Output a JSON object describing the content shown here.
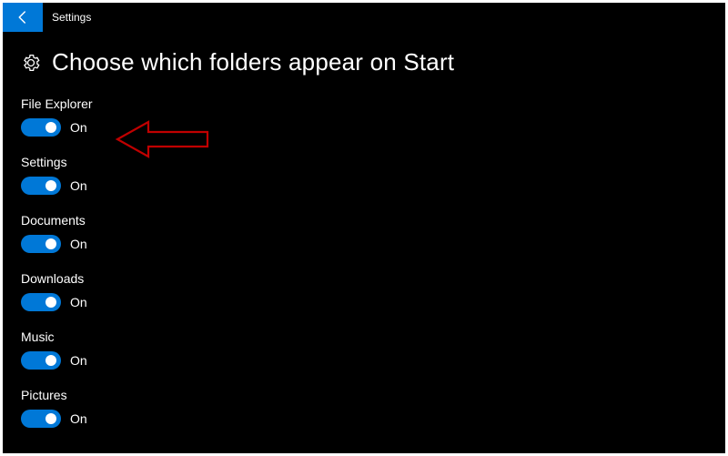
{
  "window": {
    "title": "Settings"
  },
  "page": {
    "title": "Choose which folders appear on Start"
  },
  "toggle_state_on": "On",
  "options": {
    "file_explorer": {
      "label": "File Explorer",
      "state": "On"
    },
    "settings": {
      "label": "Settings",
      "state": "On"
    },
    "documents": {
      "label": "Documents",
      "state": "On"
    },
    "downloads": {
      "label": "Downloads",
      "state": "On"
    },
    "music": {
      "label": "Music",
      "state": "On"
    },
    "pictures": {
      "label": "Pictures",
      "state": "On"
    }
  },
  "colors": {
    "accent": "#0078d7",
    "annotation": "#c00000"
  }
}
